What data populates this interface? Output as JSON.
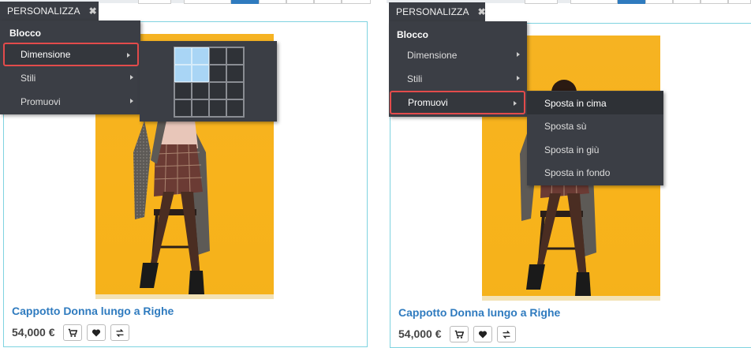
{
  "panels": [
    {
      "tab": {
        "label": "PERSONALIZZA",
        "close": "✖"
      },
      "menu": {
        "header": "Blocco",
        "items": [
          {
            "label": "Dimensione",
            "highlighted": true
          },
          {
            "label": "Stili",
            "highlighted": false
          },
          {
            "label": "Promuovi",
            "highlighted": false
          }
        ]
      },
      "size_grid": {
        "rows": 4,
        "cols": 4,
        "selected_rows": 2,
        "selected_cols": 2
      },
      "product": {
        "title": "Cappotto Donna lungo a Righe",
        "price": "54,000 €"
      }
    },
    {
      "tab": {
        "label": "PERSONALIZZA",
        "close": "✖"
      },
      "menu": {
        "header": "Blocco",
        "items": [
          {
            "label": "Dimensione",
            "highlighted": false
          },
          {
            "label": "Stili",
            "highlighted": false
          },
          {
            "label": "Promuovi",
            "highlighted": true
          }
        ]
      },
      "promote_submenu": [
        {
          "label": "Sposta in cima",
          "active": true
        },
        {
          "label": "Sposta sù",
          "active": false
        },
        {
          "label": "Sposta in giù",
          "active": false
        },
        {
          "label": "Sposta in fondo",
          "active": false
        }
      ],
      "product": {
        "title": "Cappotto Donna lungo a Righe",
        "price": "54,000 €"
      }
    }
  ],
  "icons": [
    "cart-icon",
    "heart-icon",
    "compare-icon",
    "close-icon",
    "submenu-arrow-icon"
  ],
  "colors": {
    "accent": "#2f7bbf",
    "menu_bg": "#3b3e45",
    "highlight_border": "#e34b4b",
    "grid_selected": "#a9d5f5",
    "card_border": "#7fd3e0",
    "image_bg": "#f6b322"
  }
}
